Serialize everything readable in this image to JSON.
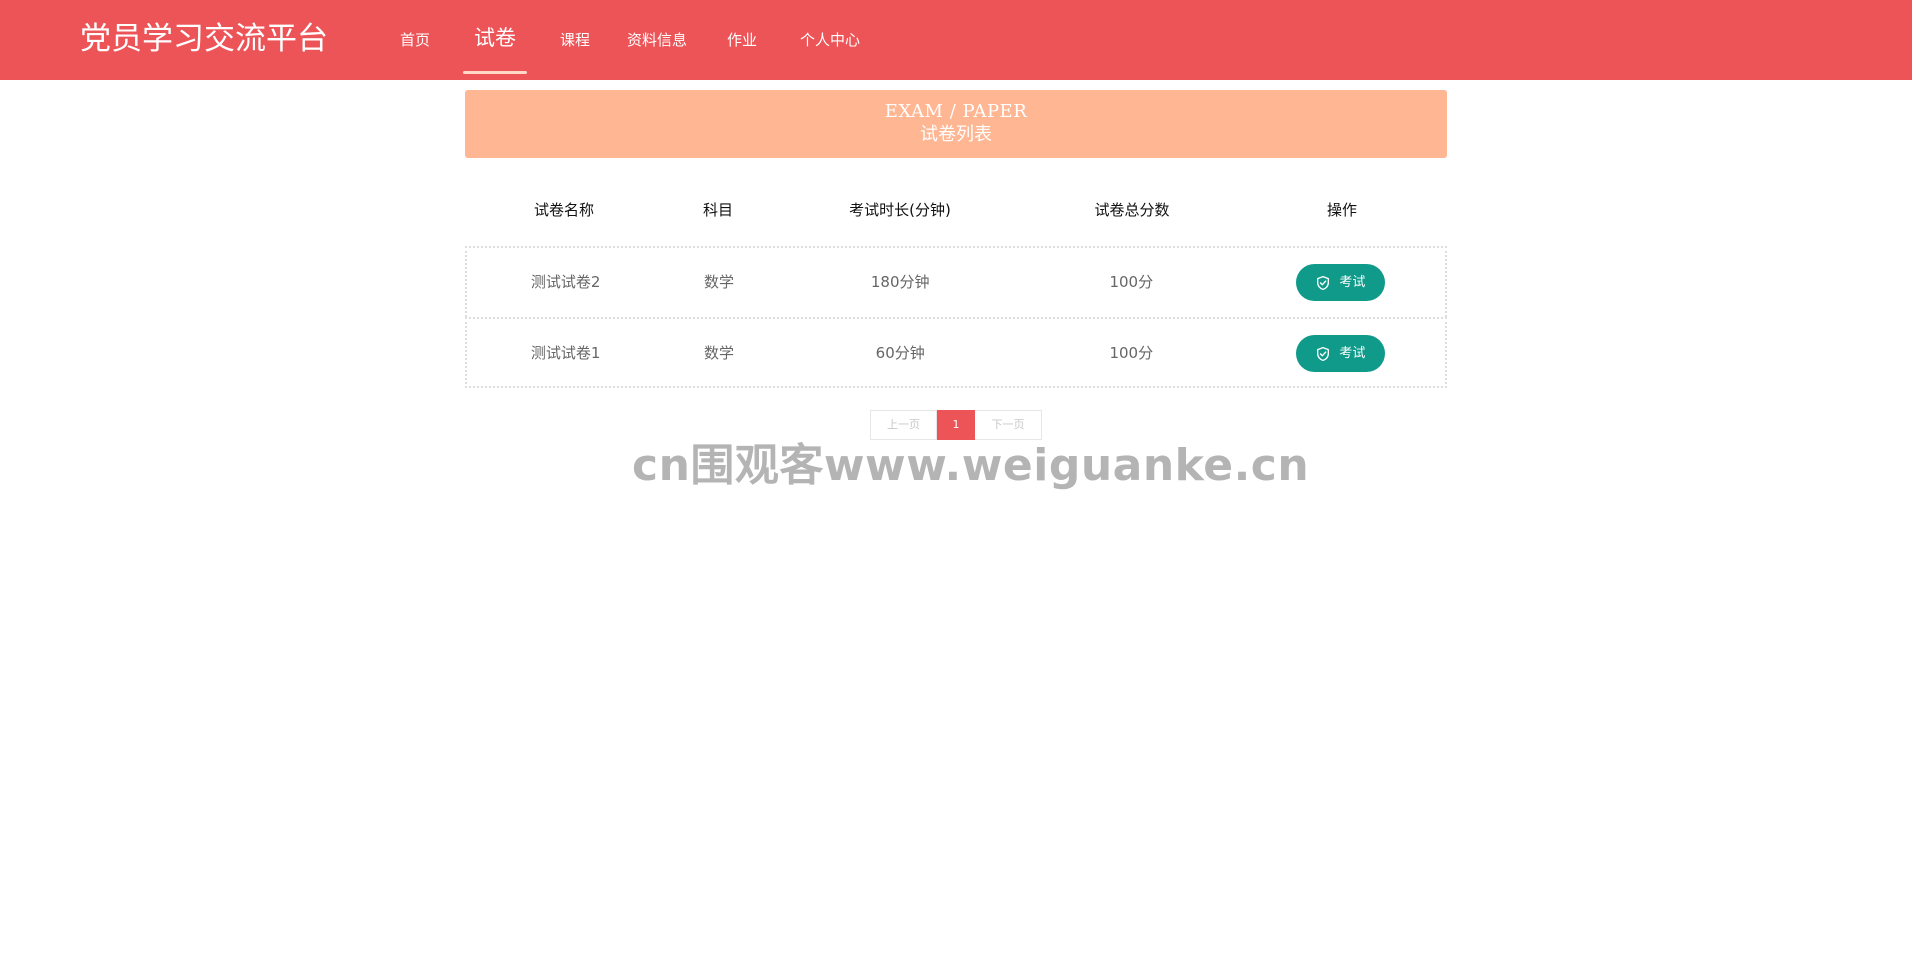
{
  "header": {
    "brand": "党员学习交流平台",
    "nav": [
      {
        "label": "首页"
      },
      {
        "label": "试卷"
      },
      {
        "label": "课程"
      },
      {
        "label": "资料信息"
      },
      {
        "label": "作业"
      },
      {
        "label": "个人中心"
      }
    ],
    "active_index": 1
  },
  "banner": {
    "title_en": "EXAM / PAPER",
    "title_cn": "试卷列表"
  },
  "table": {
    "columns": [
      "试卷名称",
      "科目",
      "考试时长(分钟)",
      "试卷总分数",
      "操作"
    ],
    "rows": [
      {
        "name": "测试试卷2",
        "subject": "数学",
        "duration": "180分钟",
        "score": "100分",
        "action": "考试"
      },
      {
        "name": "测试试卷1",
        "subject": "数学",
        "duration": "60分钟",
        "score": "100分",
        "action": "考试"
      }
    ]
  },
  "pagination": {
    "prev": "上一页",
    "current": "1",
    "next": "下一页"
  },
  "watermark": "cn围观客www.weiguanke.cn",
  "colors": {
    "header_bg": "#ec5457",
    "banner_bg": "#feb693",
    "button_bg": "#0f9a8a"
  },
  "icons": {
    "exam_button": "shield-check-icon"
  }
}
